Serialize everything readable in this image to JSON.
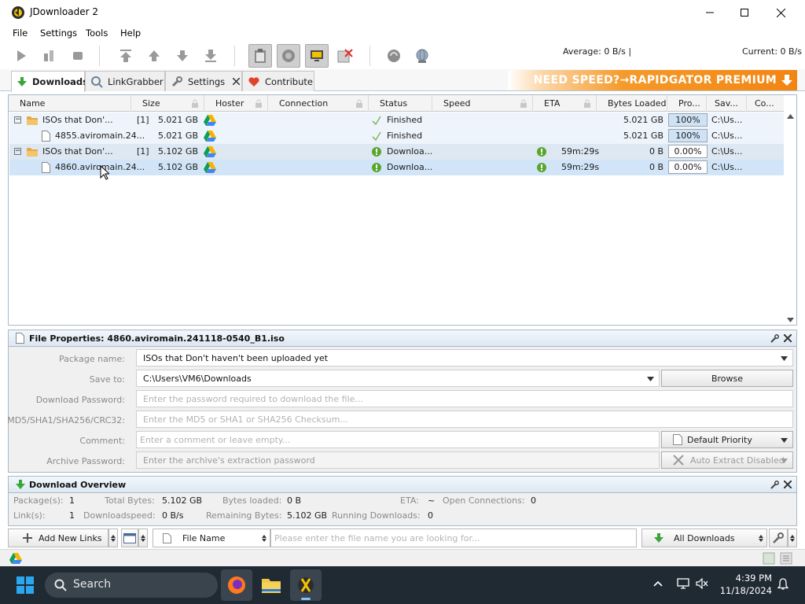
{
  "window": {
    "title": "JDownloader 2"
  },
  "menu": [
    "File",
    "Settings",
    "Tools",
    "Help"
  ],
  "toolbar": {
    "average": "Average: 0 B/s |",
    "current": "Current: 0 B/s"
  },
  "tabs": [
    {
      "label": "Downloads"
    },
    {
      "label": "LinkGrabber"
    },
    {
      "label": "Settings"
    },
    {
      "label": "Contribute"
    }
  ],
  "banner": {
    "text": "NEED SPEED?→RAPIDGATOR PREMIUM"
  },
  "table": {
    "columns": [
      "Name",
      "Size",
      "Hoster",
      "Connection",
      "Status",
      "Speed",
      "ETA",
      "Bytes Loaded",
      "Pro...",
      "Sav...",
      "Co..."
    ],
    "rows": [
      {
        "expander": "−",
        "name": "ISOs that Don'...",
        "count": "[1]",
        "size": "5.021 GB",
        "status": "Finished",
        "eta": "",
        "bytes": "5.021 GB",
        "progress": "100%",
        "progress_value": 1.0,
        "save": "C:\\Us...",
        "kind": "package",
        "state": "finished"
      },
      {
        "expander": "",
        "name": "4855.aviromain.24...",
        "count": "",
        "size": "5.021 GB",
        "status": "Finished",
        "eta": "",
        "bytes": "5.021 GB",
        "progress": "100%",
        "progress_value": 1.0,
        "save": "C:\\Us...",
        "kind": "file",
        "state": "finished"
      },
      {
        "expander": "−",
        "name": "ISOs that Don'...",
        "count": "[1]",
        "size": "5.102 GB",
        "status": "Downloa...",
        "eta": "59m:29s",
        "bytes": "0 B",
        "progress": "0.00%",
        "progress_value": 0.0,
        "save": "C:\\Us...",
        "kind": "package",
        "state": "downloading"
      },
      {
        "expander": "",
        "name": "4860.aviromain.24...",
        "count": "",
        "size": "5.102 GB",
        "status": "Downloa...",
        "eta": "59m:29s",
        "bytes": "0 B",
        "progress": "0.00%",
        "progress_value": 0.0,
        "save": "C:\\Us...",
        "kind": "file",
        "state": "downloading"
      }
    ]
  },
  "properties": {
    "title": "File Properties: 4860.aviromain.241118-0540_B1.iso",
    "package_label": "Package name:",
    "package_value": "ISOs that Don't haven't been uploaded yet",
    "save_label": "Save to:",
    "save_value": "C:\\Users\\VM6\\Downloads",
    "browse": "Browse",
    "password_label": "Download Password:",
    "password_placeholder": "Enter the password required to download the file...",
    "checksum_label": "MD5/SHA1/SHA256/CRC32:",
    "checksum_placeholder": "Enter the MD5 or SHA1 or SHA256 Checksum...",
    "comment_label": "Comment:",
    "comment_placeholder": "Enter a comment or leave empty...",
    "priority": "Default Priority",
    "archive_label": "Archive Password:",
    "archive_placeholder": "Enter the archive's extraction password",
    "auto_extract": "Auto Extract Disabled"
  },
  "overview": {
    "title": "Download Overview",
    "packages_label": "Package(s):",
    "packages": "1",
    "total_label": "Total Bytes:",
    "total": "5.102 GB",
    "loaded_label": "Bytes loaded:",
    "loaded": "0 B",
    "eta_label": "ETA:",
    "eta": "~",
    "conn_label": "Open Connections:",
    "conn": "0",
    "links_label": "Link(s):",
    "links": "1",
    "speed_label": "Downloadspeed:",
    "speed": "0 B/s",
    "remaining_label": "Remaining Bytes:",
    "remaining": "5.102 GB",
    "running_label": "Running Downloads:",
    "running": "0"
  },
  "bottombar": {
    "add_links": "Add New Links",
    "search_field": "File Name",
    "search_placeholder": "Please enter the file name you are looking for...",
    "filter": "All Downloads"
  },
  "taskbar": {
    "search": "Search",
    "time": "4:39 PM",
    "date": "11/18/2024"
  },
  "colors": {
    "accent_blue": "#d9e9f8",
    "banner_orange": "#f28512",
    "taskbar": "#202a33"
  }
}
